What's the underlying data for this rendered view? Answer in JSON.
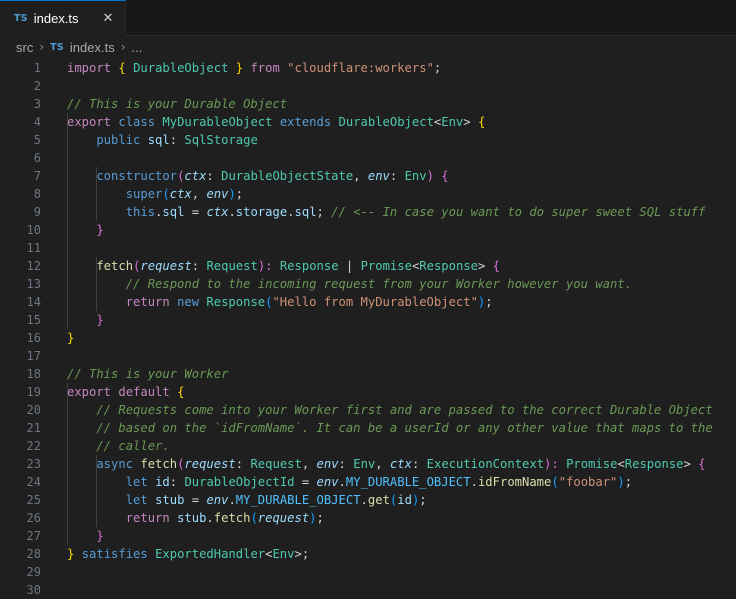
{
  "tab": {
    "icon_text": "TS",
    "label": "index.ts",
    "close_glyph": "✕"
  },
  "breadcrumb": {
    "folder": "src",
    "file_icon_text": "TS",
    "file": "index.ts",
    "more": "..."
  },
  "colors": {
    "accent": "#0078d4",
    "background": "#1f1f1f"
  },
  "code_lines": [
    [
      [
        "import ",
        "kwc"
      ],
      [
        "{ ",
        "brk1"
      ],
      [
        "DurableObject",
        "cls"
      ],
      [
        " } ",
        "brk1"
      ],
      [
        "from ",
        "kwc"
      ],
      [
        "\"cloudflare:workers\"",
        "str"
      ],
      [
        ";",
        "pun"
      ]
    ],
    [],
    [
      [
        "// This is your Durable Object",
        "com"
      ]
    ],
    [
      [
        "export ",
        "kwc"
      ],
      [
        "class ",
        "kw"
      ],
      [
        "MyDurableObject ",
        "cls"
      ],
      [
        "extends ",
        "kw"
      ],
      [
        "DurableObject",
        "cls"
      ],
      [
        "<",
        "pun"
      ],
      [
        "Env",
        "cls"
      ],
      [
        "> ",
        "pun"
      ],
      [
        "{",
        "brk1"
      ]
    ],
    [
      [
        "    public ",
        "kw"
      ],
      [
        "sql",
        "var"
      ],
      [
        ": ",
        "pun"
      ],
      [
        "SqlStorage",
        "cls"
      ]
    ],
    [],
    [
      [
        "    constructor",
        "kw"
      ],
      [
        "(",
        "brk2"
      ],
      [
        "ctx",
        "ivar"
      ],
      [
        ": ",
        "pun"
      ],
      [
        "DurableObjectState",
        "cls"
      ],
      [
        ", ",
        "pun"
      ],
      [
        "env",
        "ivar"
      ],
      [
        ": ",
        "pun"
      ],
      [
        "Env",
        "cls"
      ],
      [
        ") ",
        "brk2"
      ],
      [
        "{",
        "brk2"
      ]
    ],
    [
      [
        "        super",
        "kw"
      ],
      [
        "(",
        "brk3"
      ],
      [
        "ctx",
        "ivar"
      ],
      [
        ", ",
        "pun"
      ],
      [
        "env",
        "ivar"
      ],
      [
        ")",
        "brk3"
      ],
      [
        ";",
        "pun"
      ]
    ],
    [
      [
        "        this",
        "kw"
      ],
      [
        ".",
        "pun"
      ],
      [
        "sql",
        "var"
      ],
      [
        " = ",
        "pun"
      ],
      [
        "ctx",
        "ivar"
      ],
      [
        ".",
        "pun"
      ],
      [
        "storage",
        "var"
      ],
      [
        ".",
        "pun"
      ],
      [
        "sql",
        "var"
      ],
      [
        "; ",
        "pun"
      ],
      [
        "// <-- In case you want to do super sweet SQL stuff",
        "com"
      ]
    ],
    [
      [
        "    }",
        "brk2"
      ]
    ],
    [],
    [
      [
        "    fetch",
        "fn"
      ],
      [
        "(",
        "brk2"
      ],
      [
        "request",
        "ivar"
      ],
      [
        ": ",
        "pun"
      ],
      [
        "Request",
        "cls"
      ],
      [
        "): ",
        "brk2"
      ],
      [
        "Response",
        "cls"
      ],
      [
        " | ",
        "pun"
      ],
      [
        "Promise",
        "cls"
      ],
      [
        "<",
        "pun"
      ],
      [
        "Response",
        "cls"
      ],
      [
        "> ",
        "pun"
      ],
      [
        "{",
        "brk2"
      ]
    ],
    [
      [
        "        // Respond to the incoming request from your Worker however you want.",
        "com"
      ]
    ],
    [
      [
        "        return ",
        "kwc"
      ],
      [
        "new ",
        "kw"
      ],
      [
        "Response",
        "cls"
      ],
      [
        "(",
        "brk3"
      ],
      [
        "\"Hello from MyDurableObject\"",
        "str"
      ],
      [
        ")",
        "brk3"
      ],
      [
        ";",
        "pun"
      ]
    ],
    [
      [
        "    }",
        "brk2"
      ]
    ],
    [
      [
        "}",
        "brk1"
      ]
    ],
    [],
    [
      [
        "// This is your Worker",
        "com"
      ]
    ],
    [
      [
        "export ",
        "kwc"
      ],
      [
        "default ",
        "kwc"
      ],
      [
        "{",
        "brk1"
      ]
    ],
    [
      [
        "    // Requests come into your Worker first and are passed to the correct Durable Object",
        "com"
      ]
    ],
    [
      [
        "    // based on the `idFromName`. It can be a userId or any other value that maps to the",
        "com"
      ]
    ],
    [
      [
        "    // caller.",
        "com"
      ]
    ],
    [
      [
        "    async ",
        "kw"
      ],
      [
        "fetch",
        "fn"
      ],
      [
        "(",
        "brk2"
      ],
      [
        "request",
        "ivar"
      ],
      [
        ": ",
        "pun"
      ],
      [
        "Request",
        "cls"
      ],
      [
        ", ",
        "pun"
      ],
      [
        "env",
        "ivar"
      ],
      [
        ": ",
        "pun"
      ],
      [
        "Env",
        "cls"
      ],
      [
        ", ",
        "pun"
      ],
      [
        "ctx",
        "ivar"
      ],
      [
        ": ",
        "pun"
      ],
      [
        "ExecutionContext",
        "cls"
      ],
      [
        "): ",
        "brk2"
      ],
      [
        "Promise",
        "cls"
      ],
      [
        "<",
        "pun"
      ],
      [
        "Response",
        "cls"
      ],
      [
        "> ",
        "pun"
      ],
      [
        "{",
        "brk2"
      ]
    ],
    [
      [
        "        let ",
        "kw"
      ],
      [
        "id",
        "var"
      ],
      [
        ": ",
        "pun"
      ],
      [
        "DurableObjectId",
        "cls"
      ],
      [
        " = ",
        "pun"
      ],
      [
        "env",
        "ivar"
      ],
      [
        ".",
        "pun"
      ],
      [
        "MY_DURABLE_OBJECT",
        "con"
      ],
      [
        ".",
        "pun"
      ],
      [
        "idFromName",
        "fn"
      ],
      [
        "(",
        "brk3"
      ],
      [
        "\"foobar\"",
        "str"
      ],
      [
        ")",
        "brk3"
      ],
      [
        ";",
        "pun"
      ]
    ],
    [
      [
        "        let ",
        "kw"
      ],
      [
        "stub",
        "var"
      ],
      [
        " = ",
        "pun"
      ],
      [
        "env",
        "ivar"
      ],
      [
        ".",
        "pun"
      ],
      [
        "MY_DURABLE_OBJECT",
        "con"
      ],
      [
        ".",
        "pun"
      ],
      [
        "get",
        "fn"
      ],
      [
        "(",
        "brk3"
      ],
      [
        "id",
        "var"
      ],
      [
        ")",
        "brk3"
      ],
      [
        ";",
        "pun"
      ]
    ],
    [
      [
        "        return ",
        "kwc"
      ],
      [
        "stub",
        "var"
      ],
      [
        ".",
        "pun"
      ],
      [
        "fetch",
        "fn"
      ],
      [
        "(",
        "brk3"
      ],
      [
        "request",
        "ivar"
      ],
      [
        ")",
        "brk3"
      ],
      [
        ";",
        "pun"
      ]
    ],
    [
      [
        "    }",
        "brk2"
      ]
    ],
    [
      [
        "} ",
        "brk1"
      ],
      [
        "satisfies ",
        "kw"
      ],
      [
        "ExportedHandler",
        "cls"
      ],
      [
        "<",
        "pun"
      ],
      [
        "Env",
        "cls"
      ],
      [
        ">",
        "pun"
      ],
      [
        ";",
        "pun"
      ]
    ],
    [],
    []
  ]
}
